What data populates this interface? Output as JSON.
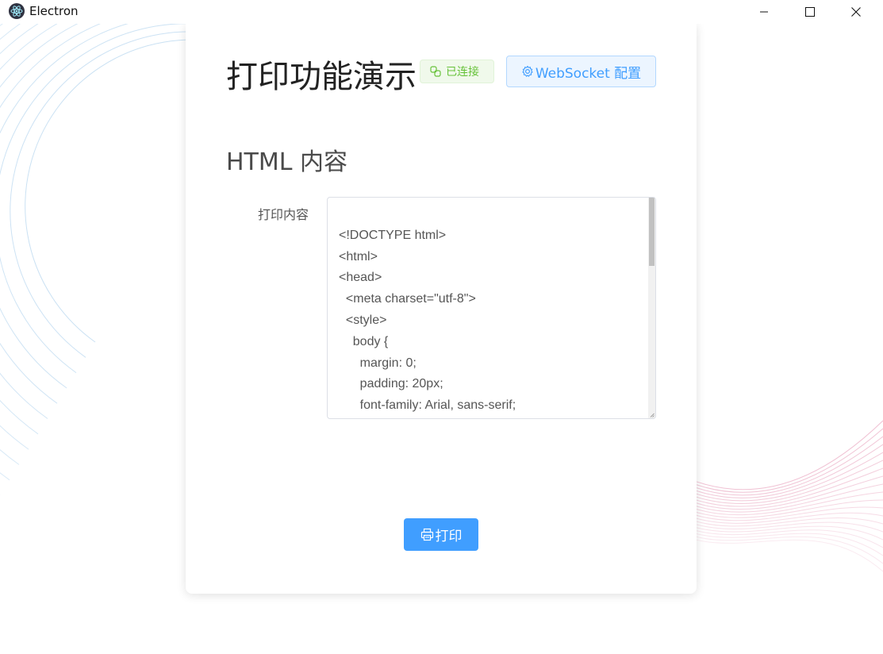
{
  "window": {
    "title": "Electron"
  },
  "page": {
    "title": "打印功能演示",
    "status_tag": "已连接",
    "ws_button_label": "WebSocket 配置",
    "section_title": "HTML 内容",
    "field_label": "打印内容",
    "content_value": "\n<!DOCTYPE html>\n<html>\n<head>\n  <meta charset=\"utf-8\">\n  <style>\n    body {\n      margin: 0;\n      padding: 20px;\n      font-family: Arial, sans-serif;\n    }",
    "print_button_label": "打印"
  },
  "colors": {
    "primary": "#409eff",
    "success": "#67c23a",
    "bg_lines_blue": "#bcd9f0",
    "bg_lines_pink": "#e8a3bf"
  },
  "icons": {
    "app": "electron-logo-icon",
    "status": "link-icon",
    "ws_button": "gear-icon",
    "print_button": "printer-icon"
  }
}
